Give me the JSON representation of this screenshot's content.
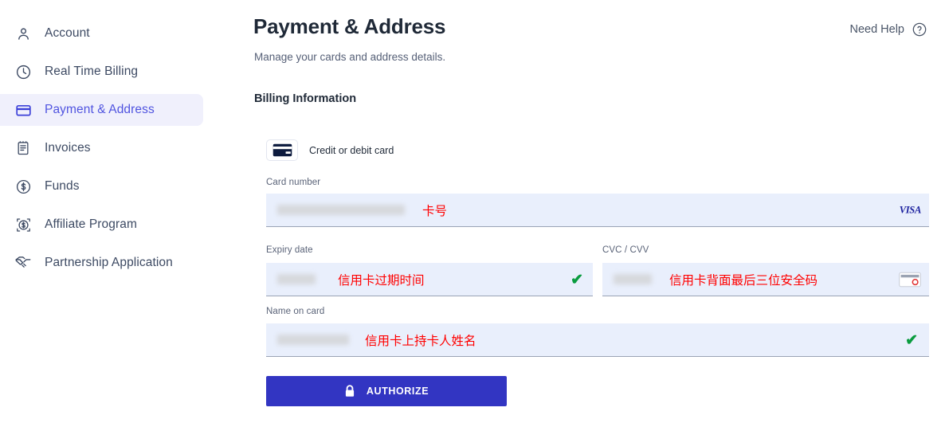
{
  "sidebar": {
    "items": [
      {
        "label": "Account",
        "icon": "user-icon",
        "active": false
      },
      {
        "label": "Real Time Billing",
        "icon": "clock-icon",
        "active": false
      },
      {
        "label": "Payment & Address",
        "icon": "credit-card-icon",
        "active": true
      },
      {
        "label": "Invoices",
        "icon": "invoice-icon",
        "active": false
      },
      {
        "label": "Funds",
        "icon": "dollar-circle-icon",
        "active": false
      },
      {
        "label": "Affiliate Program",
        "icon": "affiliate-dollar-icon",
        "active": false
      },
      {
        "label": "Partnership Application",
        "icon": "handshake-icon",
        "active": false
      }
    ]
  },
  "header": {
    "title": "Payment & Address",
    "subtitle": "Manage your cards and address details.",
    "need_help_label": "Need Help",
    "need_help_icon": "question-circle-icon"
  },
  "billing": {
    "section_title": "Billing Information",
    "card_type": {
      "label": "Credit or debit card",
      "icon": "credit-card-icon"
    },
    "fields": {
      "card_number": {
        "label": "Card number",
        "value": "",
        "annotation": "卡号",
        "brand_badge": "VISA",
        "valid": false
      },
      "expiry": {
        "label": "Expiry date",
        "value": "",
        "annotation": "信用卡过期时间",
        "valid": true,
        "check_mark": "✔"
      },
      "cvc": {
        "label": "CVC / CVV",
        "value": "",
        "annotation": "信用卡背面最后三位安全码",
        "icon": "card-back-cvv-icon",
        "valid": false
      },
      "name_on_card": {
        "label": "Name on card",
        "value": "",
        "annotation": "信用卡上持卡人姓名",
        "valid": true,
        "check_mark": "✔"
      }
    },
    "authorize": {
      "label": "AUTHORIZE",
      "icon": "lock-icon"
    }
  },
  "colors": {
    "accent": "#3235c2",
    "sidebar_active_bg": "#f0f0fc",
    "sidebar_active_text": "#5054e0",
    "field_bg": "#e9effc",
    "annotation_red": "#ff0000",
    "check_green": "#0a9c3f",
    "visa_blue": "#1a1f9e"
  }
}
